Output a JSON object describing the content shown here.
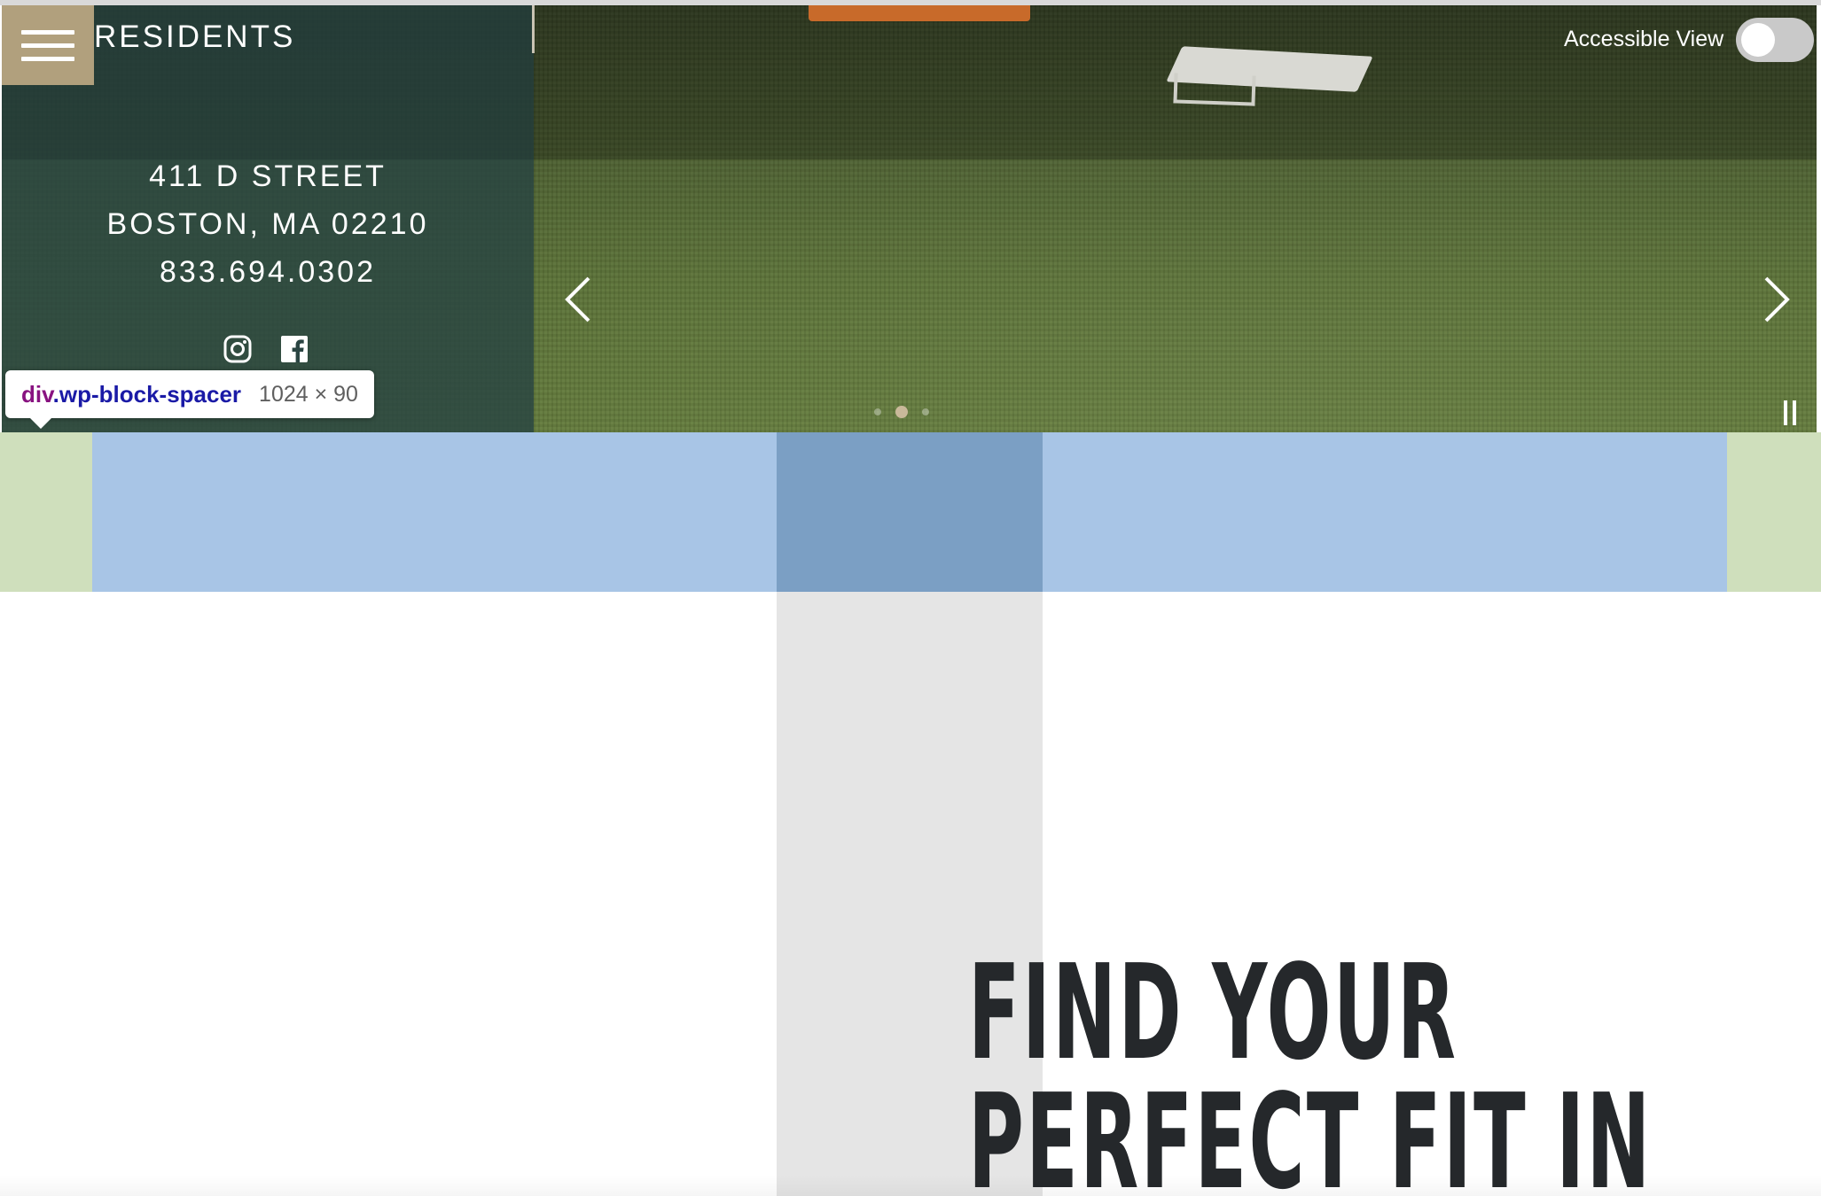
{
  "header": {
    "brand": "RESIDENTS",
    "menu_icon": "hamburger-menu-icon"
  },
  "contact": {
    "address_line1": "411 D STREET",
    "address_line2": "BOSTON, MA 02210",
    "phone": "833.694.0302",
    "social_icons": [
      "instagram-icon",
      "facebook-icon"
    ]
  },
  "accessibility": {
    "label": "Accessible View",
    "toggle_on": false
  },
  "slider": {
    "prev_icon": "chevron-left-icon",
    "next_icon": "chevron-right-icon",
    "pause_icon": "pause-icon",
    "slide_count": 3,
    "active_slide_index": 1
  },
  "devtools": {
    "tooltip_tag": "div",
    "tooltip_class": ".wp-block-spacer",
    "tooltip_size": "1024 × 90"
  },
  "main": {
    "headline_line1": "FIND YOUR",
    "headline_line2": "PERFECT FIT IN"
  },
  "colors": {
    "panel": "#284442",
    "menu_button": "#b1a07d",
    "headline": "#25282b",
    "overlay_content": "#a8c5e6",
    "overlay_gap": "#7b9fc4",
    "overlay_margin": "#cfdfbc",
    "overlay_column": "#e5e5e5"
  }
}
